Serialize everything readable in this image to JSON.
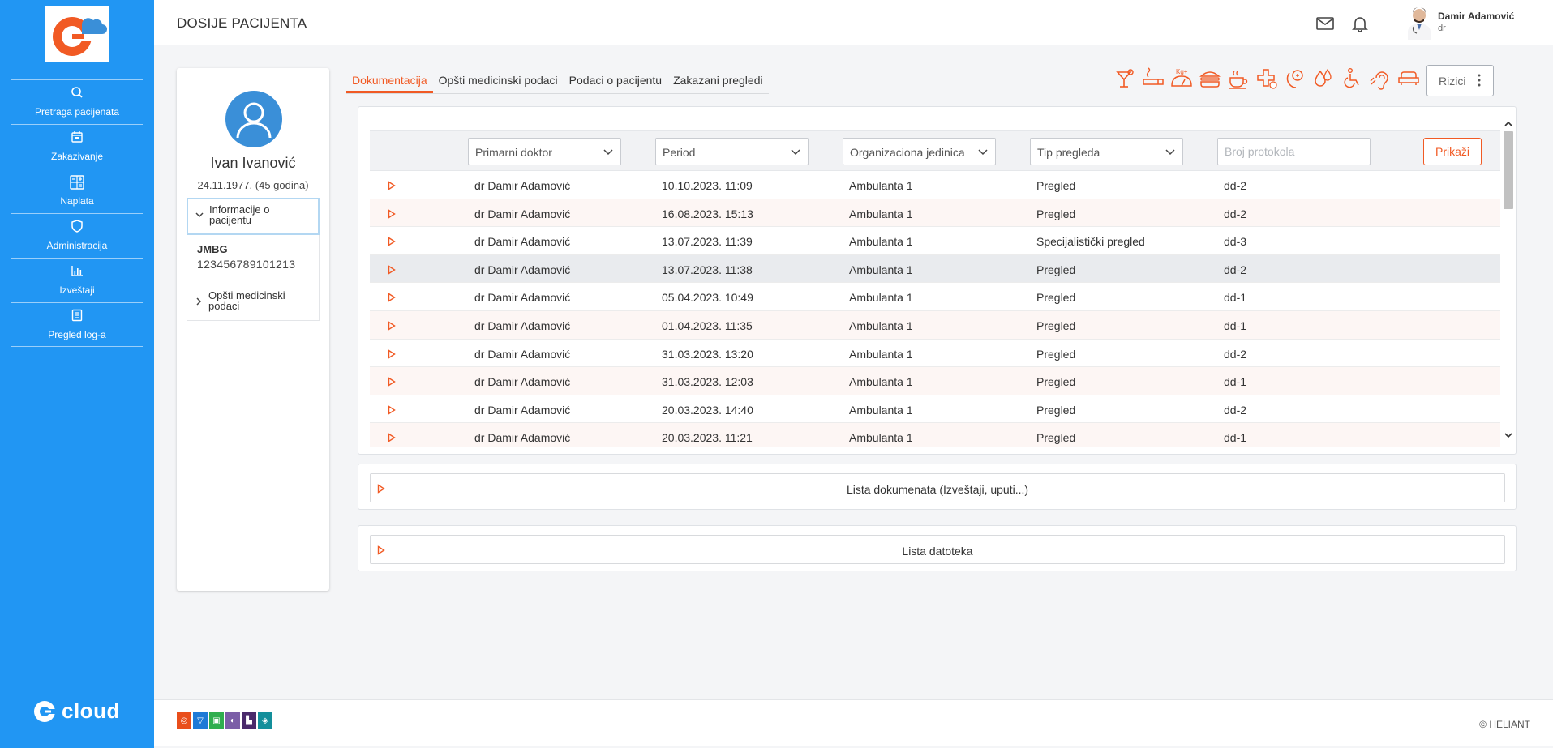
{
  "brand": {
    "cloud_label": "cloud",
    "accent_color": "#f15a24",
    "sidebar_color": "#2196f3"
  },
  "sidebar": {
    "items": [
      {
        "label": "Pretraga pacijenata",
        "icon": "search-icon"
      },
      {
        "label": "Zakazivanje",
        "icon": "calendar-icon"
      },
      {
        "label": "Naplata",
        "icon": "calculator-icon"
      },
      {
        "label": "Administracija",
        "icon": "shield-icon"
      },
      {
        "label": "Izveštaji",
        "icon": "bar-chart-icon"
      },
      {
        "label": "Pregled log-a",
        "icon": "document-icon"
      }
    ]
  },
  "header": {
    "title": "DOSIJE PACIJENTA",
    "user_name": "Damir Adamović",
    "user_role": "dr"
  },
  "patient": {
    "name": "Ivan Ivanović",
    "dob": "24.11.1977. (45 godina)",
    "info_section": "Informacije o pacijentu",
    "jmbg_label": "JMBG",
    "jmbg_value": "123456789101213",
    "medical_section": "Opšti medicinski podaci"
  },
  "tabs": [
    {
      "label": "Dokumentacija",
      "active": true
    },
    {
      "label": "Opšti medicinski podaci",
      "active": false
    },
    {
      "label": "Podaci o pacijentu",
      "active": false
    },
    {
      "label": "Zakazani pregledi",
      "active": false
    }
  ],
  "risks": {
    "button_label": "Rizici",
    "icons": [
      "cocktail-icon",
      "cigarette-icon",
      "weight-icon",
      "burger-icon",
      "coffee-icon",
      "medical-cross-icon",
      "virus-icon",
      "drops-icon",
      "wheelchair-icon",
      "hearing-icon",
      "sofa-icon"
    ]
  },
  "filters": {
    "doctor": "Primarni doktor",
    "period": "Period",
    "unit": "Organizaciona jedinica",
    "exam_type": "Tip pregleda",
    "protocol_placeholder": "Broj protokola",
    "show_button": "Prikaži"
  },
  "exams": [
    {
      "doctor": "dr Damir Adamović",
      "date": "10.10.2023. 11:09",
      "unit": "Ambulanta 1",
      "type": "Pregled",
      "protocol": "dd-2"
    },
    {
      "doctor": "dr Damir Adamović",
      "date": "16.08.2023. 15:13",
      "unit": "Ambulanta 1",
      "type": "Pregled",
      "protocol": "dd-2"
    },
    {
      "doctor": "dr Damir Adamović",
      "date": "13.07.2023. 11:39",
      "unit": "Ambulanta 1",
      "type": "Specijalistički pregled",
      "protocol": "dd-3"
    },
    {
      "doctor": "dr Damir Adamović",
      "date": "13.07.2023. 11:38",
      "unit": "Ambulanta 1",
      "type": "Pregled",
      "protocol": "dd-2"
    },
    {
      "doctor": "dr Damir Adamović",
      "date": "05.04.2023. 10:49",
      "unit": "Ambulanta 1",
      "type": "Pregled",
      "protocol": "dd-1"
    },
    {
      "doctor": "dr Damir Adamović",
      "date": "01.04.2023. 11:35",
      "unit": "Ambulanta 1",
      "type": "Pregled",
      "protocol": "dd-1"
    },
    {
      "doctor": "dr Damir Adamović",
      "date": "31.03.2023. 13:20",
      "unit": "Ambulanta 1",
      "type": "Pregled",
      "protocol": "dd-2"
    },
    {
      "doctor": "dr Damir Adamović",
      "date": "31.03.2023. 12:03",
      "unit": "Ambulanta 1",
      "type": "Pregled",
      "protocol": "dd-1"
    },
    {
      "doctor": "dr Damir Adamović",
      "date": "20.03.2023. 14:40",
      "unit": "Ambulanta 1",
      "type": "Pregled",
      "protocol": "dd-2"
    },
    {
      "doctor": "dr Damir Adamović",
      "date": "20.03.2023. 11:21",
      "unit": "Ambulanta 1",
      "type": "Pregled",
      "protocol": "dd-1"
    }
  ],
  "panels": {
    "documents": "Lista dokumenata (Izveštaji, uputi...)",
    "files": "Lista datoteka"
  },
  "footer": {
    "copyright": "© HELIANT",
    "badge_colors": [
      "#e94e1b",
      "#1f7ad6",
      "#2fae4e",
      "#7b5ea7",
      "#4a2a6b",
      "#138f9b"
    ]
  }
}
